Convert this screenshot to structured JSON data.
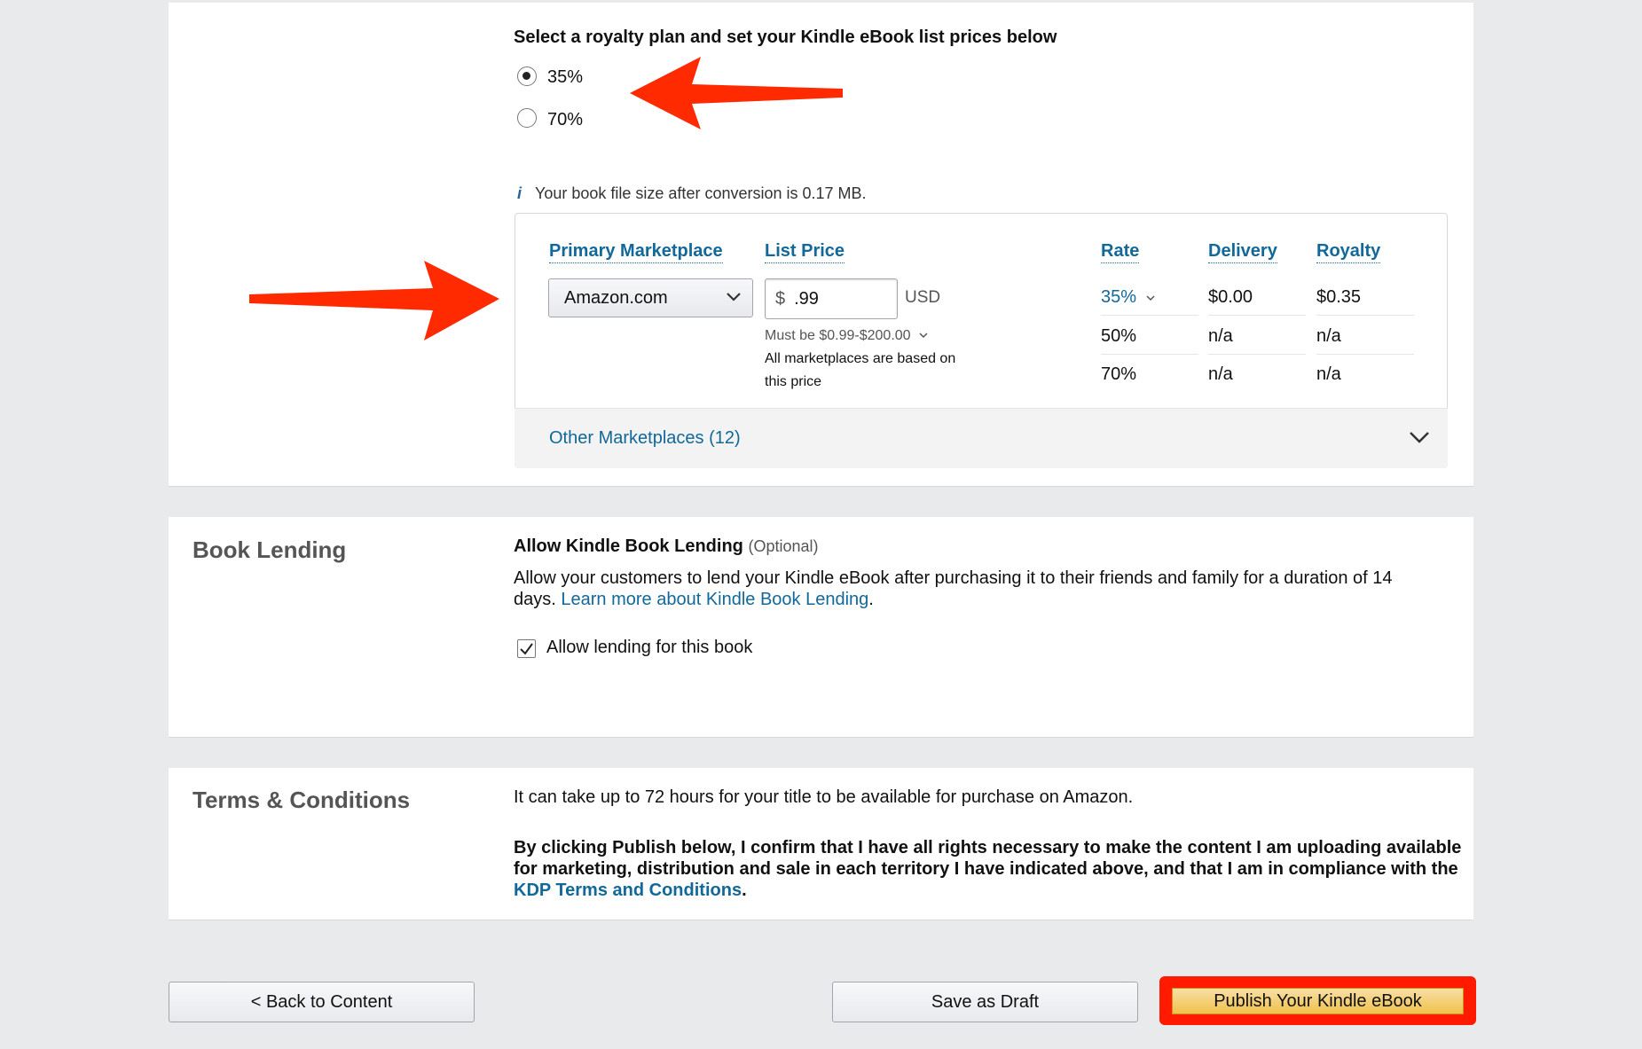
{
  "royalty": {
    "heading": "Select a royalty plan and set your Kindle eBook list prices below",
    "options": [
      {
        "label": "35%",
        "selected": true
      },
      {
        "label": "70%",
        "selected": false
      }
    ],
    "file_size_note": "Your book file size after conversion is 0.17 MB.",
    "info_icon": "i"
  },
  "pricing_table": {
    "headers": {
      "marketplace": "Primary Marketplace",
      "list_price": "List Price",
      "rate": "Rate",
      "delivery": "Delivery",
      "royalty": "Royalty"
    },
    "marketplace_value": "Amazon.com",
    "currency_symbol": "$",
    "price_value": ".99",
    "currency_code": "USD",
    "must_be": "Must be $0.99-$200.00",
    "based_on": "All marketplaces are based on",
    "based_on_2": "this price",
    "rows": [
      {
        "rate": "35%",
        "delivery": "$0.00",
        "royalty": "$0.35"
      },
      {
        "rate": "50%",
        "delivery": "n/a",
        "royalty": "n/a"
      },
      {
        "rate": "70%",
        "delivery": "n/a",
        "royalty": "n/a"
      }
    ],
    "other_marketplaces": "Other Marketplaces (12)"
  },
  "lending": {
    "section_title": "Book Lending",
    "heading": "Allow Kindle Book Lending",
    "optional": "(Optional)",
    "description": "Allow your customers to lend your Kindle eBook after purchasing it to their friends and family for a duration of 14",
    "description_2": "days.",
    "learn_more": "Learn more about Kindle Book Lending",
    "period": ".",
    "checkbox_label": "Allow lending for this book",
    "checkbox_checked": true
  },
  "terms": {
    "section_title": "Terms & Conditions",
    "availability": "It can take up to 72 hours for your title to be available for purchase on Amazon.",
    "confirm_1": "By clicking Publish below, I confirm that I have all rights necessary to make the content I am uploading available",
    "confirm_2": "for marketing, distribution and sale in each territory I have indicated above, and that I am in compliance with the",
    "kdp_link": "KDP Terms and Conditions",
    "confirm_end": "."
  },
  "buttons": {
    "back": "< Back to Content",
    "draft": "Save as Draft",
    "publish": "Publish Your Kindle eBook"
  },
  "colors": {
    "link": "#116899",
    "annotation_arrow": "#ff2a00",
    "publish_highlight": "#ff1a00",
    "publish_button": "#f0c14b"
  }
}
